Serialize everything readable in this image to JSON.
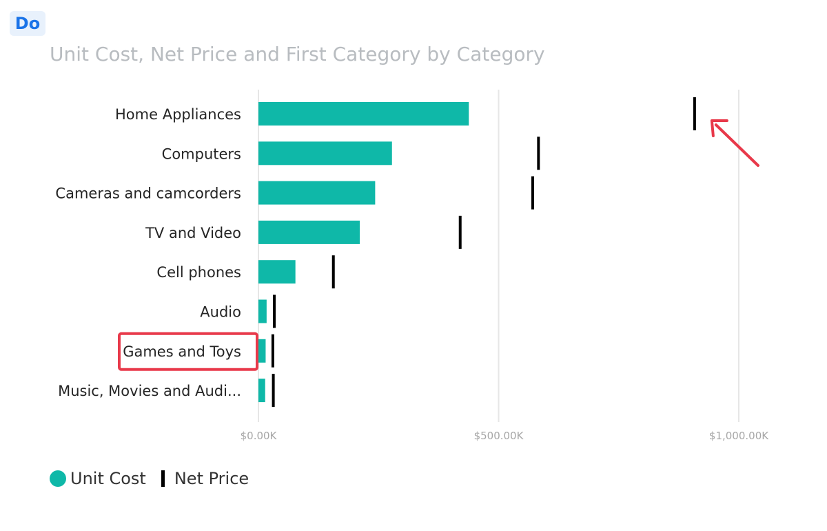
{
  "badge": {
    "label": "Do"
  },
  "chart_data": {
    "type": "bar",
    "orientation": "horizontal",
    "title": "Unit Cost, Net Price and First Category by Category",
    "categories": [
      "Home Appliances",
      "Computers",
      "Cameras and camcorders",
      "TV and Video",
      "Cell phones",
      "Audio",
      "Games and Toys",
      "Music, Movies and Audi..."
    ],
    "series": [
      {
        "name": "Unit Cost",
        "kind": "bar",
        "values": [
          438,
          278,
          243,
          211,
          77,
          17,
          15,
          14
        ]
      },
      {
        "name": "Net Price",
        "kind": "tick-marker",
        "values": [
          908,
          583,
          571,
          420,
          156,
          33,
          30,
          31
        ]
      }
    ],
    "xlim": [
      0,
      1150
    ],
    "xticks": [
      0,
      500,
      1000
    ],
    "xtick_labels": [
      "$0.00K",
      "$500.00K",
      "$1,000.00K"
    ],
    "grid": true,
    "legend": "bottom-left",
    "colors": {
      "unit_cost": "#0fb8a8",
      "net_price": "#000000",
      "annotation": "#e8394a"
    },
    "annotations": [
      {
        "type": "arrow",
        "target": "Home Appliances Net Price"
      },
      {
        "type": "box",
        "target": "Games and Toys"
      }
    ]
  }
}
